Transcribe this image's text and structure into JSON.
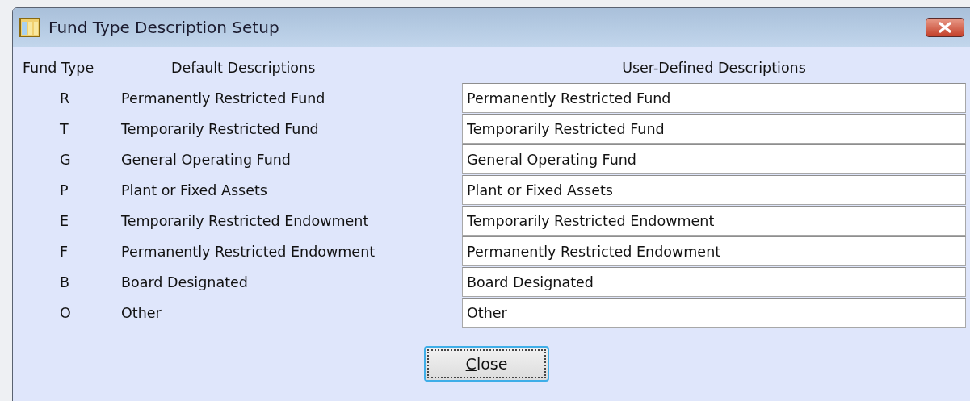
{
  "window": {
    "title": "Fund Type Description Setup"
  },
  "columns": [
    "Fund Type",
    "Default Descriptions",
    "User-Defined Descriptions"
  ],
  "rows": [
    {
      "fund_type": "R",
      "default": "Permanently Restricted Fund",
      "user_defined": "Permanently Restricted Fund"
    },
    {
      "fund_type": "T",
      "default": "Temporarily Restricted Fund",
      "user_defined": "Temporarily Restricted Fund"
    },
    {
      "fund_type": "G",
      "default": "General Operating Fund",
      "user_defined": "General Operating Fund"
    },
    {
      "fund_type": "P",
      "default": "Plant or Fixed Assets",
      "user_defined": "Plant or Fixed Assets"
    },
    {
      "fund_type": "E",
      "default": "Temporarily Restricted Endowment",
      "user_defined": "Temporarily Restricted Endowment"
    },
    {
      "fund_type": "F",
      "default": "Permanently Restricted Endowment",
      "user_defined": "Permanently Restricted Endowment"
    },
    {
      "fund_type": "B",
      "default": "Board Designated",
      "user_defined": "Board Designated"
    },
    {
      "fund_type": "O",
      "default": "Other",
      "user_defined": "Other"
    }
  ],
  "buttons": [
    {
      "label": "Close"
    }
  ]
}
